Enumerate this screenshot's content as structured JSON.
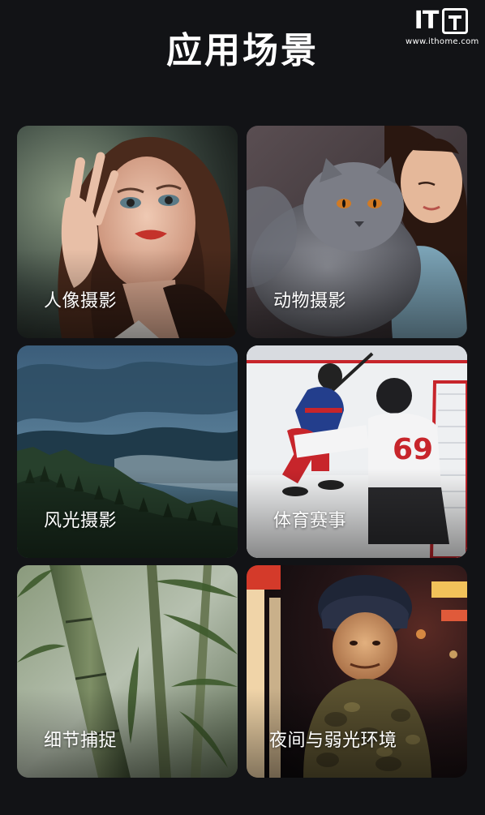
{
  "header": {
    "title": "应用场景"
  },
  "watermark": {
    "logo_text": "IT",
    "url": "www.ithome.com"
  },
  "cards": [
    {
      "label": "人像摄影",
      "icon": "portrait-photo"
    },
    {
      "label": "动物摄影",
      "icon": "cat-photo"
    },
    {
      "label": "风光摄影",
      "icon": "landscape-photo"
    },
    {
      "label": "体育赛事",
      "icon": "hockey-photo"
    },
    {
      "label": "细节捕捉",
      "icon": "bamboo-photo"
    },
    {
      "label": "夜间与弱光环境",
      "icon": "night-photo"
    }
  ],
  "colors": {
    "background": "#121316",
    "text": "#ffffff"
  }
}
